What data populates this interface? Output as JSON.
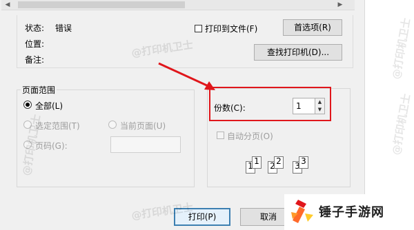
{
  "status_panel": {
    "status_label": "状态:",
    "status_value": "错误",
    "location_label": "位置:",
    "comment_label": "备注:",
    "print_to_file_label": "打印到文件(F)",
    "preferences_button": "首选项(R)",
    "find_printer_button": "查找打印机(D)..."
  },
  "page_range": {
    "title": "页面范围",
    "all_label": "全部(L)",
    "selection_label": "选定范围(T)",
    "current_page_label": "当前页面(U)",
    "pages_label": "页码(G):",
    "pages_value": ""
  },
  "copies": {
    "copies_label": "份数(C):",
    "copies_value": "1",
    "collate_label": "自动分页(O)",
    "collate_preview": [
      "1",
      "1",
      "2",
      "2",
      "3",
      "3"
    ]
  },
  "footer": {
    "print_button": "打印(P)",
    "cancel_button": "取消"
  },
  "watermark": {
    "text": "@打印机卫士"
  },
  "branding": {
    "site_name": "锤子手游网"
  },
  "colors": {
    "highlight": "#e0161b",
    "arrow": "#e0161b",
    "primary_border": "#3c7fb1"
  }
}
